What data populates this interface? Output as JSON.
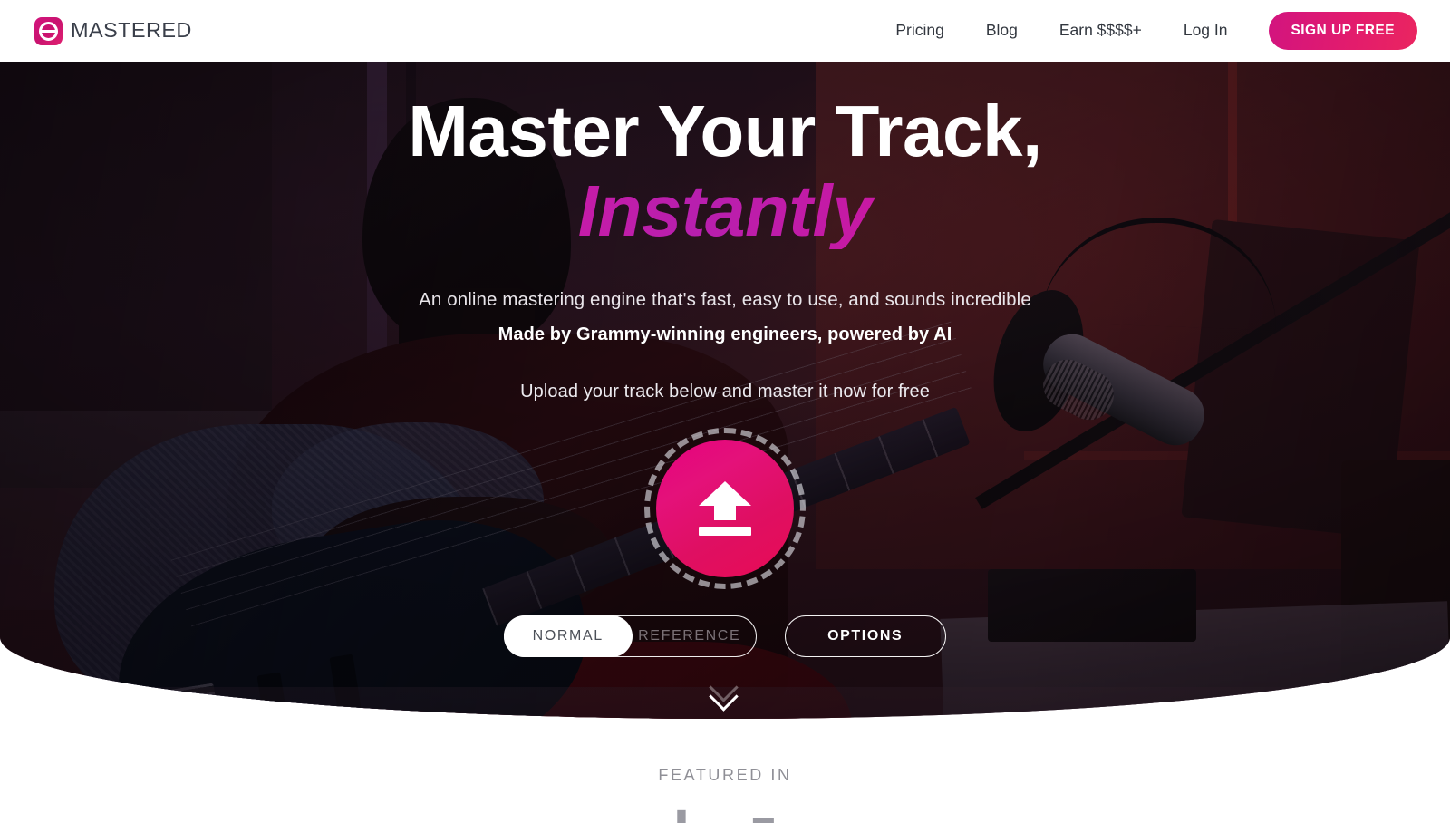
{
  "header": {
    "logo": {
      "icon": "emastered-e-logo-icon",
      "wordmark": "MASTERED"
    },
    "nav": [
      {
        "label": "Pricing"
      },
      {
        "label": "Blog"
      },
      {
        "label": "Earn $$$$+"
      },
      {
        "label": "Log In"
      }
    ],
    "signup_label": "SIGN UP FREE",
    "signup_gradient_from": "#d2147f",
    "signup_gradient_to": "#ea2560"
  },
  "hero": {
    "headline_line1": "Master Your Track,",
    "headline_line2": "Instantly",
    "headline_accent_color": "#e0179a",
    "subheadline": "An online mastering engine that's fast, easy to use, and sounds incredible",
    "credibility": "Made by Grammy-winning engineers, powered by AI",
    "upload_prompt": "Upload your track below and master it now for free",
    "upload": {
      "icon": "upload-arrow-icon",
      "circle_gradient_from": "#e6007e",
      "circle_gradient_to": "#e80b55"
    },
    "modes": {
      "normal_label": "NORMAL",
      "reference_label": "REFERENCE",
      "active": "NORMAL"
    },
    "options_label": "OPTIONS",
    "scroll_indicator_icon": "chevron-down-icon"
  },
  "featured": {
    "title": "FEATURED IN",
    "logos": [
      {
        "name": "partner-logo-1"
      },
      {
        "name": "partner-logo-2"
      }
    ]
  }
}
